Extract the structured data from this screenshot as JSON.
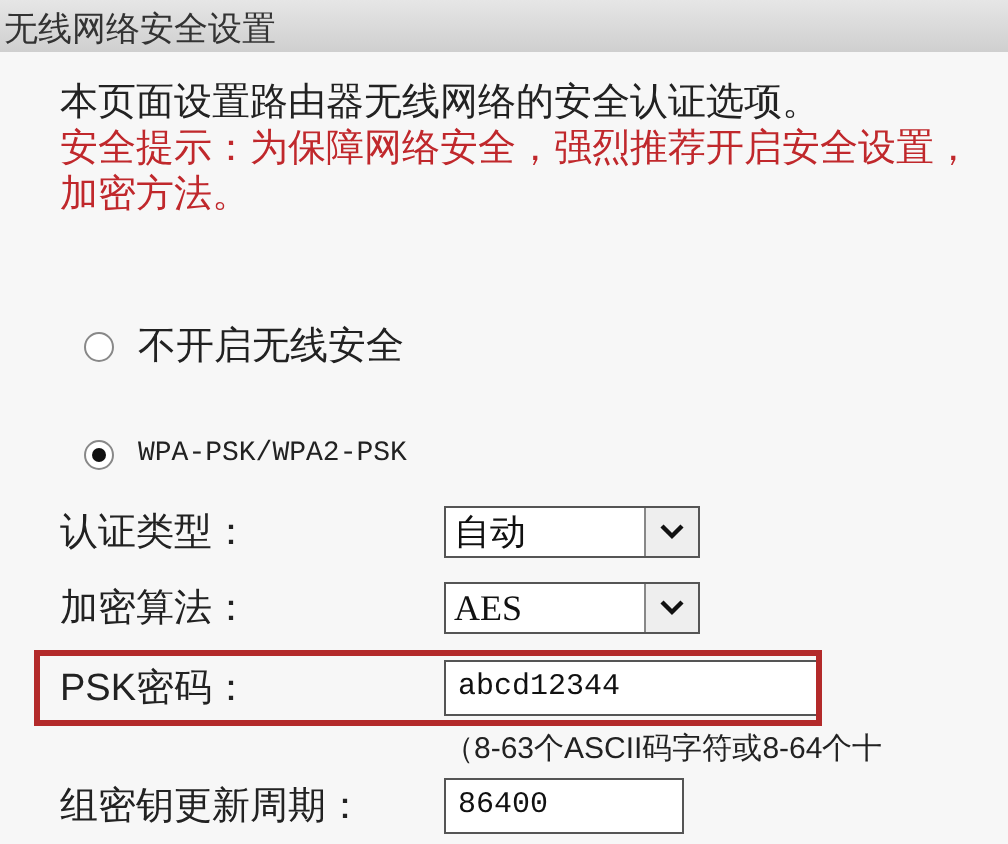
{
  "title": "无线网络安全设置",
  "intro": "本页面设置路由器无线网络的安全认证选项。",
  "tip": "安全提示：为保障网络安全，强烈推荐开启安全设置，",
  "tip_continued": "加密方法。",
  "modes": [
    {
      "label": "不开启无线安全",
      "selected": false
    },
    {
      "label": "WPA-PSK/WPA2-PSK",
      "selected": true
    }
  ],
  "fields": [
    {
      "kind": "select",
      "label": "认证类型：",
      "value": "自动",
      "highlighted": false
    },
    {
      "kind": "select",
      "label": "加密算法：",
      "value": "AES",
      "highlighted": false
    },
    {
      "kind": "input",
      "label": "PSK密码：",
      "value": "abcd12344",
      "highlighted": true,
      "hint": "（8-63个ASCII码字符或8-64个十"
    },
    {
      "kind": "input",
      "label": "组密钥更新周期：",
      "value": "86400",
      "highlighted": false
    }
  ]
}
